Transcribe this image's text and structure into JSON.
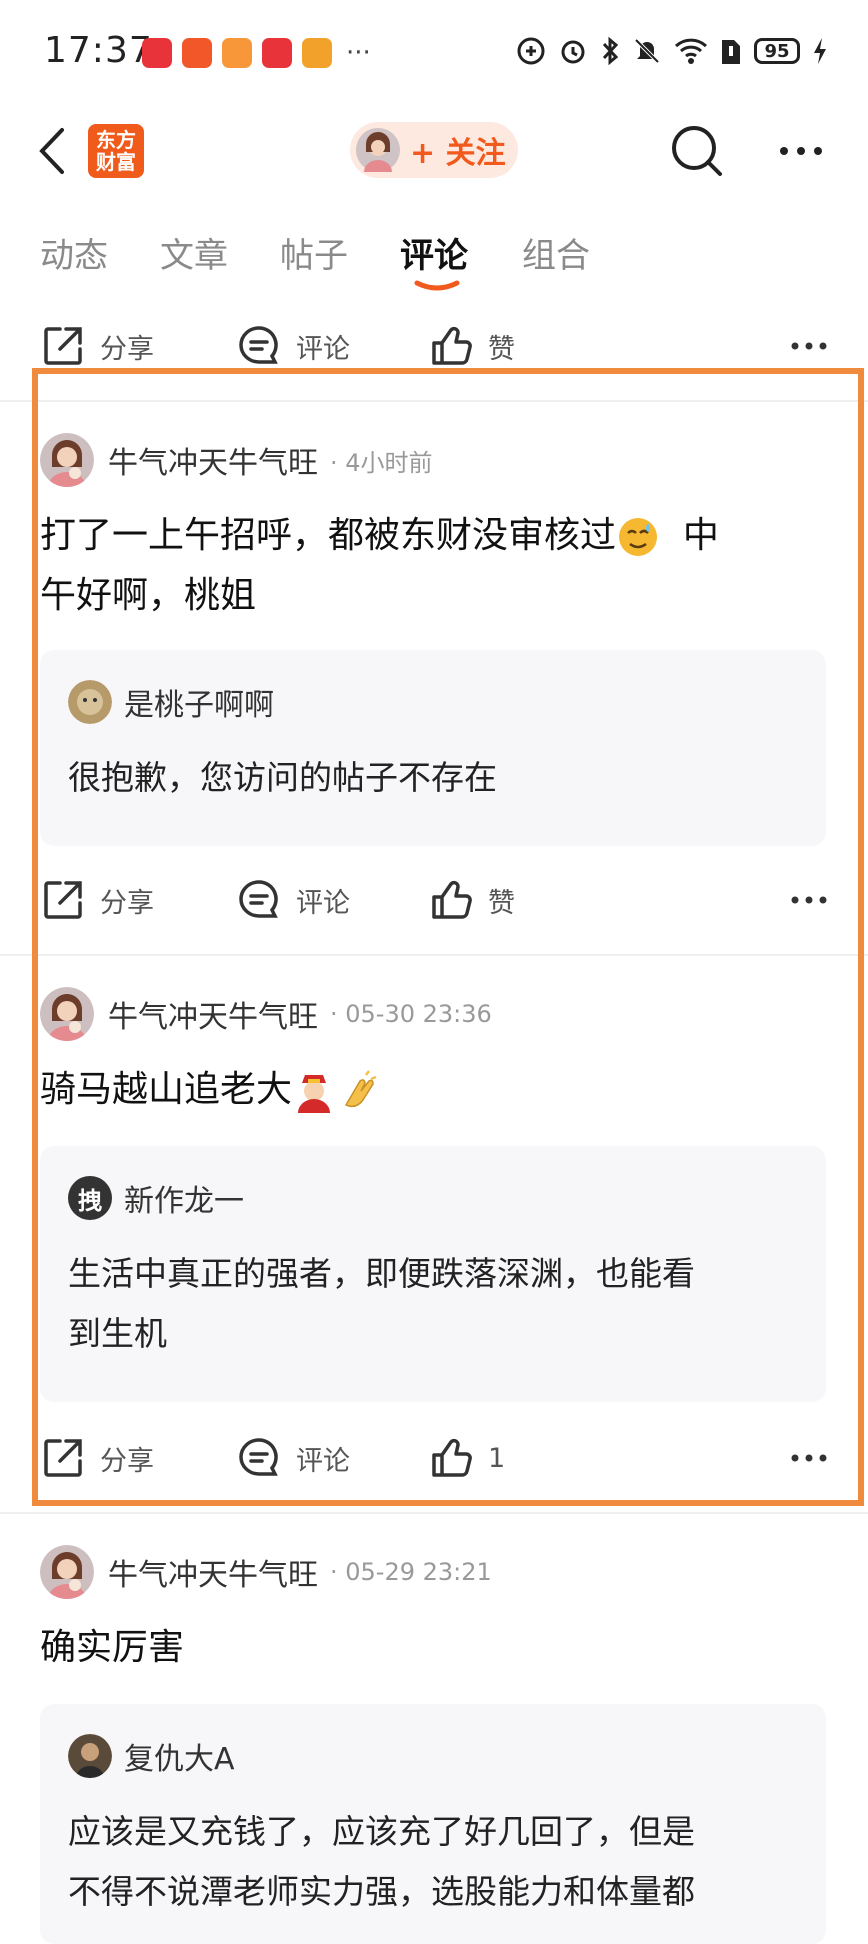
{
  "status_bar": {
    "time": "17:37",
    "more": "···",
    "battery": "95"
  },
  "header": {
    "logo_line1": "东方",
    "logo_line2": "财富",
    "follow_label": "+ 关注"
  },
  "tabs": [
    {
      "label": "动态"
    },
    {
      "label": "文章"
    },
    {
      "label": "帖子"
    },
    {
      "label": "评论"
    },
    {
      "label": "组合"
    }
  ],
  "actions": {
    "share": "分享",
    "comment": "评论",
    "like": "赞"
  },
  "posts": [
    {
      "author": "牛气冲天牛气旺",
      "time": "· 4小时前",
      "text_line1": "打了一上午招呼，都被东财没审核过",
      "text_line1b": "中",
      "text_line2": "午好啊，桃姐",
      "quote_author": "是桃子啊啊",
      "quote_text": "很抱歉，您访问的帖子不存在",
      "like_label": "赞"
    },
    {
      "author": "牛气冲天牛气旺",
      "time": "· 05-30 23:36",
      "text": "骑马越山追老大",
      "quote_author": "新作龙一",
      "quote_avatar_char": "拽",
      "quote_text_line1": "生活中真正的强者，即便跌落深渊，也能看",
      "quote_text_line2": "到生机",
      "like_label": "1"
    },
    {
      "author": "牛气冲天牛气旺",
      "time": "· 05-29 23:21",
      "text": "确实厉害",
      "quote_author": "复仇大A",
      "quote_text_line1": "应该是又充钱了，应该充了好几回了，但是",
      "quote_text_line2": "不得不说潭老师实力强，选股能力和体量都"
    }
  ],
  "colors": {
    "accent": "#f15a1c",
    "highlight": "#f08a3c",
    "quote_bg": "#f7f7f9"
  },
  "icons": [
    "back-arrow-icon",
    "search-icon",
    "more-dots-icon",
    "share-icon",
    "comment-icon",
    "thumbs-up-icon"
  ]
}
